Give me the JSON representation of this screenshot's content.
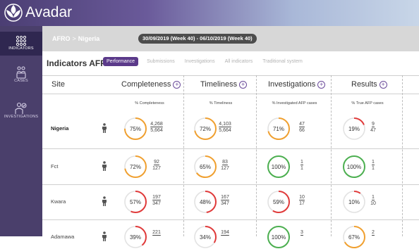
{
  "app": {
    "name": "Avadar"
  },
  "sidebar": {
    "items": [
      {
        "label": "INDICATORS",
        "icon": "dots-grid-icon",
        "active": true
      },
      {
        "label": "CASES",
        "icon": "people-icon",
        "active": false
      },
      {
        "label": "INVESTIGATIONS",
        "icon": "person-search-icon",
        "active": false
      }
    ]
  },
  "breadcrumb": {
    "region": "AFRO",
    "separator": ">",
    "country": "Nigeria",
    "date_range": "30/09/2019 (Week 40) - 06/10/2019 (Week 40)"
  },
  "page": {
    "title": "Indicators AFP"
  },
  "tabs": [
    {
      "label": "Performance",
      "active": true
    },
    {
      "label": "Submissions",
      "active": false
    },
    {
      "label": "Investigations",
      "active": false
    },
    {
      "label": "All indicators",
      "active": false
    },
    {
      "label": "Traditional system",
      "active": false
    }
  ],
  "table": {
    "headers": {
      "site": "Site",
      "completeness": "Completeness",
      "timeliness": "Timeliness",
      "investigations": "Investigations",
      "results": "Results"
    },
    "subheaders": {
      "completeness": "% Completeness",
      "timeliness": "% Timeliness",
      "investigations": "% Investigated AFP cases",
      "results": "% True AFP cases"
    },
    "rows": [
      {
        "site": "Nigeria",
        "bold": true,
        "completeness": {
          "pct": "75%",
          "num": "4,268",
          "den": "5,664",
          "value": 75
        },
        "timeliness": {
          "pct": "72%",
          "num": "4,103",
          "den": "5,664",
          "value": 72
        },
        "investigations": {
          "pct": "71%",
          "num": "47",
          "den": "66",
          "value": 71
        },
        "results": {
          "pct": "19%",
          "num": "9",
          "den": "47",
          "value": 19
        }
      },
      {
        "site": "Fct",
        "bold": false,
        "completeness": {
          "pct": "72%",
          "num": "92",
          "den": "127",
          "value": 72
        },
        "timeliness": {
          "pct": "65%",
          "num": "83",
          "den": "127",
          "value": 65
        },
        "investigations": {
          "pct": "100%",
          "num": "1",
          "den": "1",
          "value": 100
        },
        "results": {
          "pct": "100%",
          "num": "1",
          "den": "1",
          "value": 100
        }
      },
      {
        "site": "Kwara",
        "bold": false,
        "completeness": {
          "pct": "57%",
          "num": "197",
          "den": "347",
          "value": 57
        },
        "timeliness": {
          "pct": "48%",
          "num": "167",
          "den": "347",
          "value": 48
        },
        "investigations": {
          "pct": "59%",
          "num": "10",
          "den": "17",
          "value": 59
        },
        "results": {
          "pct": "10%",
          "num": "1",
          "den": "10",
          "value": 10
        }
      },
      {
        "site": "Adamawa",
        "bold": false,
        "completeness": {
          "pct": "39%",
          "num": "221",
          "den": "",
          "value": 39
        },
        "timeliness": {
          "pct": "34%",
          "num": "194",
          "den": "",
          "value": 34
        },
        "investigations": {
          "pct": "100%",
          "num": "3",
          "den": "",
          "value": 100
        },
        "results": {
          "pct": "67%",
          "num": "2",
          "den": "",
          "value": 67
        }
      }
    ]
  },
  "colors": {
    "orange": "#f0a030",
    "red": "#e03a3a",
    "green": "#4caf50",
    "track": "#e2e2e2",
    "accent": "#5b3a8a"
  }
}
